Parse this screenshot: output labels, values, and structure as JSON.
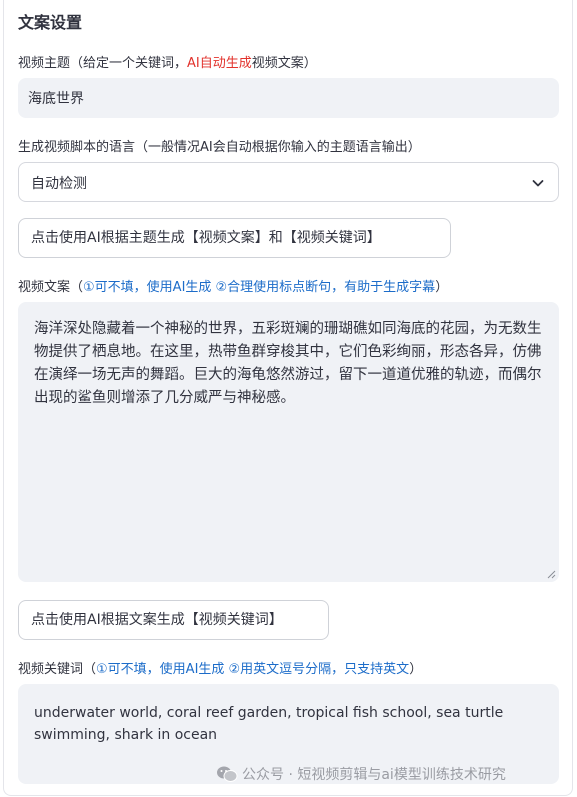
{
  "section_title": "文案设置",
  "topic": {
    "label_prefix": "视频主题（给定一个关键词，",
    "label_highlight": "AI自动生成",
    "label_suffix": "视频文案）",
    "value": "海底世界"
  },
  "language": {
    "label": "生成视频脚本的语言（一般情况AI会自动根据你输入的主题语言输出）",
    "selected": "自动检测"
  },
  "btn_generate_script": "点击使用AI根据主题生成【视频文案】和【视频关键词】",
  "script": {
    "label_prefix": "视频文案（",
    "label_hint": "①可不填，使用AI生成 ②合理使用标点断句，有助于生成字幕",
    "label_suffix": "）",
    "text": "海洋深处隐藏着一个神秘的世界，五彩斑斓的珊瑚礁如同海底的花园，为无数生物提供了栖息地。在这里，热带鱼群穿梭其中，它们色彩绚丽，形态各异，仿佛在演绎一场无声的舞蹈。巨大的海龟悠然游过，留下一道道优雅的轨迹，而偶尔出现的鲨鱼则增添了几分威严与神秘感。"
  },
  "btn_generate_keywords": "点击使用AI根据文案生成【视频关键词】",
  "keywords": {
    "label_prefix": "视频关键词（",
    "label_hint": "①可不填，使用AI生成 ②用英文逗号分隔，只支持英文",
    "label_suffix": "）",
    "value": "underwater world, coral reef garden, tropical fish school, sea turtle swimming, shark in ocean"
  },
  "watermark": "公众号 · 短视频剪辑与ai模型训练技术研究"
}
